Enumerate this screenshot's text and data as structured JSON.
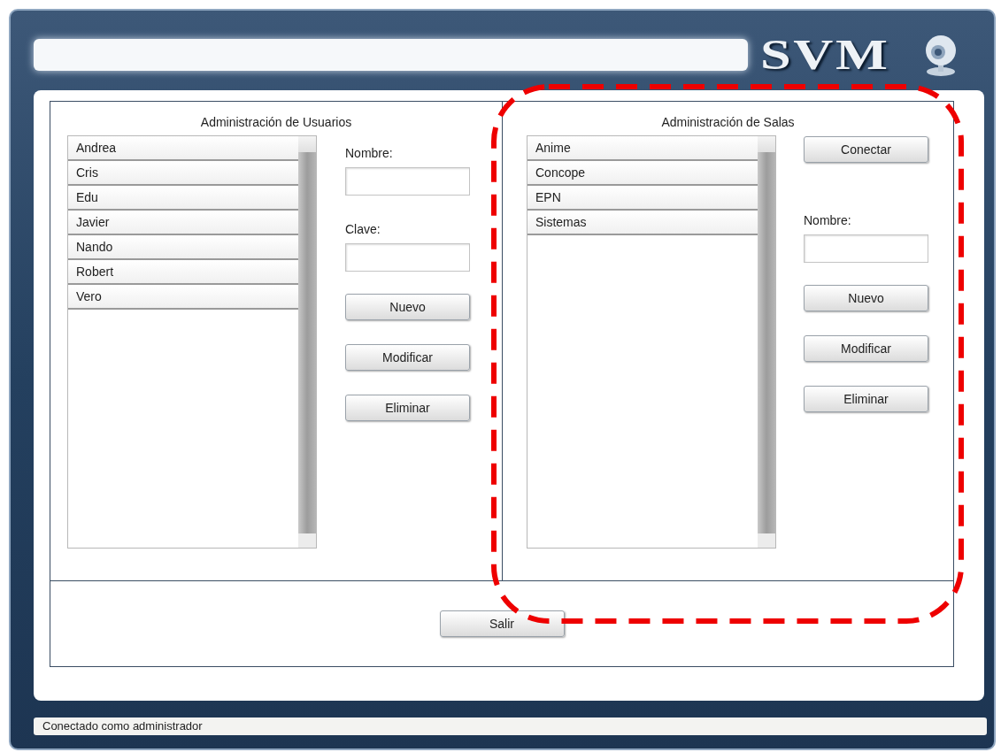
{
  "logo": "SVM",
  "users": {
    "title": "Administración de Usuarios",
    "items": [
      "Andrea",
      "Cris",
      "Edu",
      "Javier",
      "Nando",
      "Robert",
      "Vero"
    ],
    "fields": [
      {
        "label": "Nombre:"
      },
      {
        "label": "Clave:"
      }
    ],
    "buttons": [
      "Nuevo",
      "Modificar",
      "Eliminar"
    ]
  },
  "rooms": {
    "title": "Administración de Salas",
    "items": [
      "Anime",
      "Concope",
      "EPN",
      "Sistemas"
    ],
    "connect_button": "Conectar",
    "fields": [
      {
        "label": "Nombre:"
      }
    ],
    "buttons": [
      "Nuevo",
      "Modificar",
      "Eliminar"
    ]
  },
  "exit_button": "Salir",
  "status_bar": "Conectado como administrador"
}
